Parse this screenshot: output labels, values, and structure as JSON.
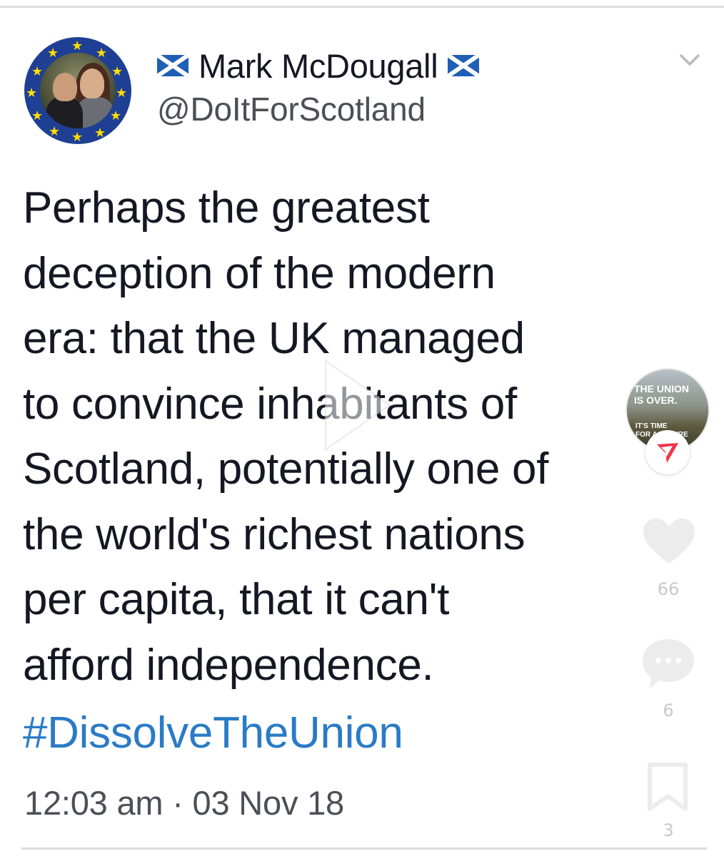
{
  "author": {
    "name": "Mark McDougall",
    "handle": "@DoItForScotland",
    "flag_color": "#1f5fb5",
    "avatar_ring_color": "#1f3f95"
  },
  "tweet": {
    "lines": [
      "Perhaps the greatest",
      "deception of the modern",
      "era: that the UK managed",
      "to convince inhabitants of",
      "Scotland, potentially one of",
      "the world's richest nations",
      "per capita, that it can't",
      "afford independence."
    ],
    "hashtag": "#DissolveTheUnion",
    "hashtag_color": "#2a7bc6",
    "timestamp": "12:03 am · 03 Nov 18"
  },
  "overlay": {
    "story_title": "THE UNION IS OVER.",
    "story_title_line1": "THE UNION",
    "story_title_line2": "IS OVER.",
    "story_sub_line1": "IT'S TIME",
    "story_sub_line2": "FOR A FUTURE",
    "likes": "66",
    "comments": "6",
    "saves": "3",
    "icons": [
      "play-icon",
      "send-icon",
      "heart-icon",
      "comment-icon",
      "bookmark-icon",
      "chevron-down-icon"
    ]
  }
}
